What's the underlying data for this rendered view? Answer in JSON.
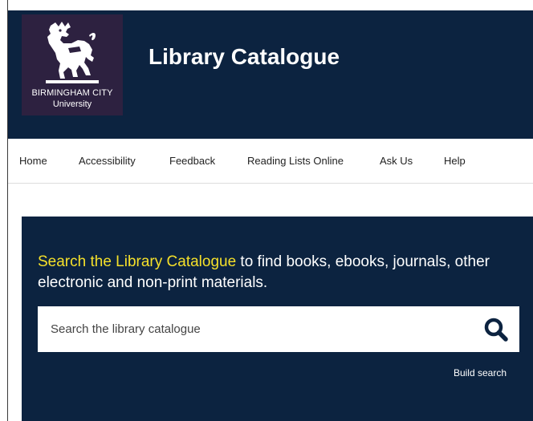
{
  "brand": {
    "logo_line1": "BIRMINGHAM CITY",
    "logo_line2": "University",
    "logo_icon": "lion-crest-icon",
    "logo_bg": "#2d2140"
  },
  "header": {
    "title": "Library Catalogue",
    "bg": "#0c2340"
  },
  "nav": {
    "items": [
      {
        "label": "Home"
      },
      {
        "label": "Accessibility"
      },
      {
        "label": "Feedback"
      },
      {
        "label": "Reading Lists Online"
      },
      {
        "label": "Ask Us"
      },
      {
        "label": "Help"
      }
    ]
  },
  "search": {
    "intro_highlight": "Search the Library Catalogue",
    "intro_rest": " to find books, ebooks, journals, other electronic and non-print materials.",
    "placeholder": "Search the library catalogue",
    "button_icon": "search-icon",
    "build_search_label": "Build search",
    "highlight_color": "#f5e02a"
  }
}
